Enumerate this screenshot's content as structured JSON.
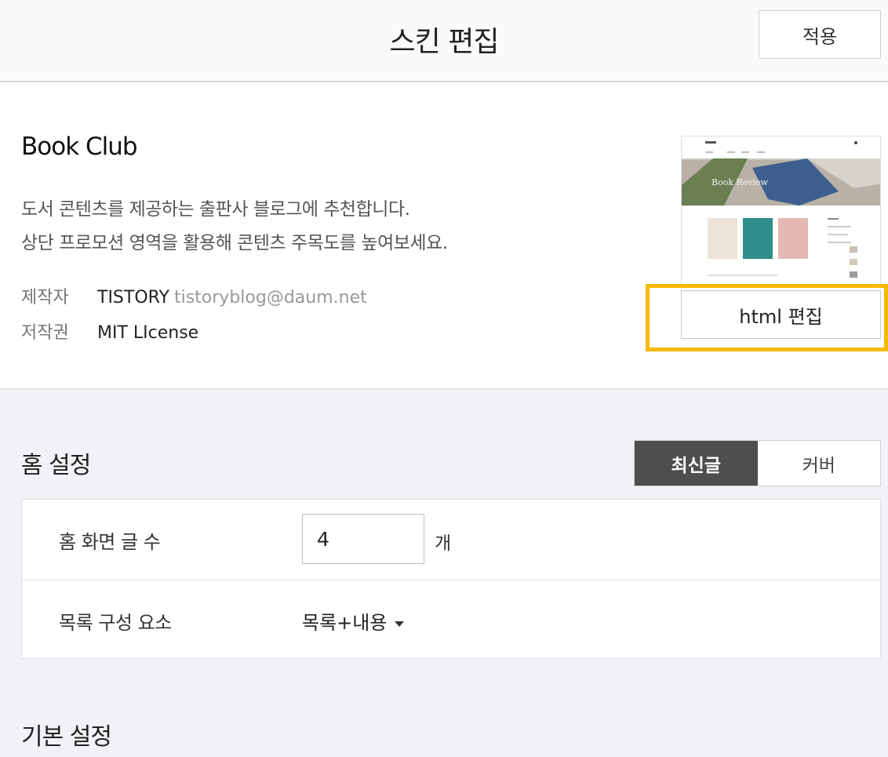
{
  "header": {
    "title": "스킨 편집",
    "apply_label": "적용"
  },
  "skin": {
    "name": "Book Club",
    "description_line1": "도서 콘텐츠를 제공하는 출판사 블로그에 추천합니다.",
    "description_line2": "상단 프로모션 영역을 활용해 콘텐츠 주목도를 높여보세요.",
    "author_label": "제작자",
    "author_name": "TISTORY",
    "author_email": "tistoryblog@daum.net",
    "license_label": "저작권",
    "license_value": "MIT LIcense",
    "thumbnail_caption": "Book Review",
    "html_edit_label": "html 편집",
    "highlight_color": "#f7b900"
  },
  "home": {
    "title": "홈 설정",
    "toggle": {
      "active_label": "최신글",
      "inactive_label": "커버"
    },
    "rows": [
      {
        "label": "홈 화면 글 수",
        "value": "4",
        "unit": "개"
      },
      {
        "label": "목록 구성 요소",
        "value": "목록+내용"
      }
    ]
  },
  "basic": {
    "title": "기본 설정"
  }
}
